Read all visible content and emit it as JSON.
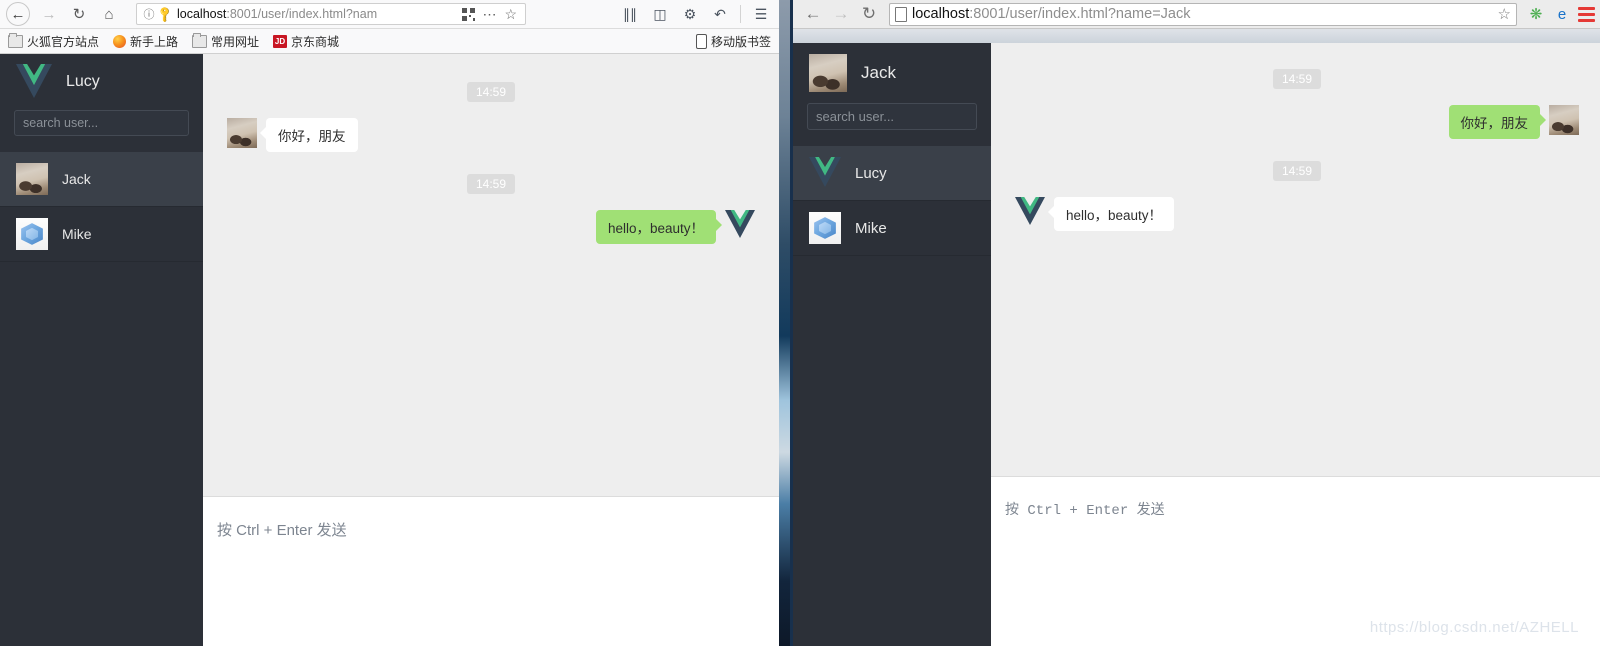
{
  "left_window": {
    "browser": "firefox",
    "nav": {
      "back_icon": "back-arrow-icon",
      "forward_icon": "forward-arrow-icon",
      "reload_icon": "reload-icon",
      "home_icon": "home-icon",
      "info_icon": "info-icon",
      "key_icon": "key-icon",
      "url_host": "localhost",
      "url_rest": ":8001/user/index.html?nam",
      "qr_icon": "qr-code-icon",
      "page_actions_icon": "ellipsis-icon",
      "bookmark_star_icon": "star-icon",
      "library_icon": "library-icon",
      "sidebar_icon": "sidebar-icon",
      "screenshot_icon": "screenshot-crop-icon",
      "undo_icon": "undo-icon",
      "menu_icon": "hamburger-menu-icon"
    },
    "bookmarks": [
      {
        "label": "火狐官方站点",
        "icon": "folder-icon"
      },
      {
        "label": "新手上路",
        "icon": "firefox-icon"
      },
      {
        "label": "常用网址",
        "icon": "folder-icon"
      },
      {
        "label": "京东商城",
        "icon": "jd-icon",
        "icon_text": "JD"
      }
    ],
    "bookmarks_right": {
      "label": "移动版书签",
      "icon": "mobile-device-icon"
    },
    "app": {
      "sidebar": {
        "user_avatar": "vue-logo-avatar",
        "user_name": "Lucy",
        "search_placeholder": "search user...",
        "contacts": [
          {
            "name": "Jack",
            "avatar": "cat-photo-avatar",
            "active": true
          },
          {
            "name": "Mike",
            "avatar": "blue-cube-avatar",
            "active": false
          }
        ]
      },
      "chat": {
        "items": [
          {
            "kind": "time",
            "text": "14:59"
          },
          {
            "kind": "message",
            "side": "left",
            "text": "你好，朋友",
            "avatar": "cat-photo-avatar",
            "bubble": "white"
          },
          {
            "kind": "time",
            "text": "14:59"
          },
          {
            "kind": "message",
            "side": "right",
            "text": "hello，beauty！",
            "avatar": "vue-logo-avatar",
            "bubble": "green"
          }
        ],
        "composer_placeholder": "按 Ctrl + Enter 发送"
      }
    }
  },
  "right_window": {
    "browser": "generic",
    "nav": {
      "back_icon": "back-arrow-icon",
      "forward_icon": "forward-arrow-icon",
      "reload_icon": "reload-icon",
      "page_icon": "page-document-icon",
      "url_host": "localhost",
      "url_rest": ":8001/user/index.html?name=Jack",
      "bookmark_star_icon": "star-icon",
      "extension_icon": "green-puzzle-extension-icon",
      "ie_tab_icon": "internet-explorer-tab-icon",
      "menu_icon": "hamburger-menu-icon"
    },
    "app": {
      "sidebar": {
        "user_avatar": "cat-photo-avatar",
        "user_name": "Jack",
        "search_placeholder": "search user...",
        "contacts": [
          {
            "name": "Lucy",
            "avatar": "vue-logo-avatar",
            "active": true
          },
          {
            "name": "Mike",
            "avatar": "blue-cube-avatar",
            "active": false
          }
        ]
      },
      "chat": {
        "items": [
          {
            "kind": "time",
            "text": "14:59"
          },
          {
            "kind": "message",
            "side": "right",
            "text": "你好，朋友",
            "avatar": "cat-photo-avatar",
            "bubble": "green"
          },
          {
            "kind": "time",
            "text": "14:59"
          },
          {
            "kind": "message",
            "side": "left",
            "text": "hello，beauty！",
            "avatar": "vue-logo-avatar",
            "bubble": "white"
          }
        ],
        "composer_placeholder": "按 Ctrl + Enter 发送"
      }
    }
  },
  "watermark": "https://blog.csdn.net/AZHELL",
  "colors": {
    "sidebar_bg": "#2c3038",
    "sidebar_active": "#3a4049",
    "chat_bg": "#eeeeee",
    "bubble_green": "#a0e075",
    "bubble_white": "#ffffff",
    "vue_green": "#41b883",
    "vue_dark": "#35495e"
  }
}
